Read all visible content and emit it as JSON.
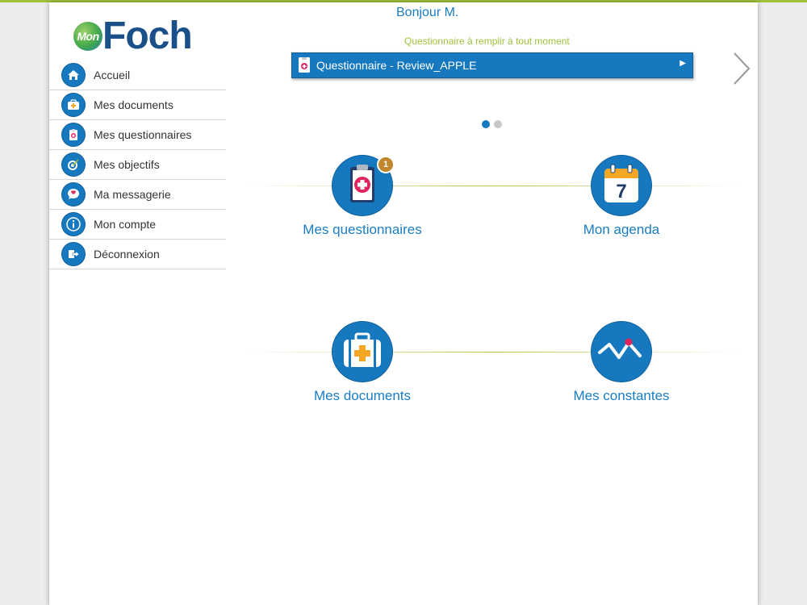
{
  "brand": {
    "logo_small": "Mon",
    "logo_large": "Foch",
    "accent": "#9dc33a",
    "primary": "#1679bf",
    "navy": "#1a4f8a"
  },
  "sidebar": {
    "items": [
      {
        "label": "Accueil",
        "icon": "home-icon"
      },
      {
        "label": "Mes documents",
        "icon": "medical-bag-icon"
      },
      {
        "label": "Mes questionnaires",
        "icon": "clipboard-icon"
      },
      {
        "label": "Mes objectifs",
        "icon": "target-icon"
      },
      {
        "label": "Ma messagerie",
        "icon": "chat-heart-icon"
      },
      {
        "label": "Mon compte",
        "icon": "info-icon"
      },
      {
        "label": "Déconnexion",
        "icon": "logout-icon"
      }
    ]
  },
  "header": {
    "greeting": "Bonjour M.",
    "subtitle": "Questionnaire à remplir à tout moment"
  },
  "banner": {
    "label": "Questionnaire - Review_APPLE",
    "arrow": "▶"
  },
  "carousel": {
    "pages": 2,
    "active": 0
  },
  "tiles": {
    "questionnaires": {
      "label": "Mes questionnaires",
      "badge": "1",
      "icon": "clipboard-icon"
    },
    "agenda": {
      "label": "Mon agenda",
      "day": "7",
      "icon": "calendar-icon"
    },
    "documents": {
      "label": "Mes documents",
      "icon": "medical-bag-icon"
    },
    "constantes": {
      "label": "Mes constantes",
      "icon": "vital-signs-icon"
    }
  }
}
